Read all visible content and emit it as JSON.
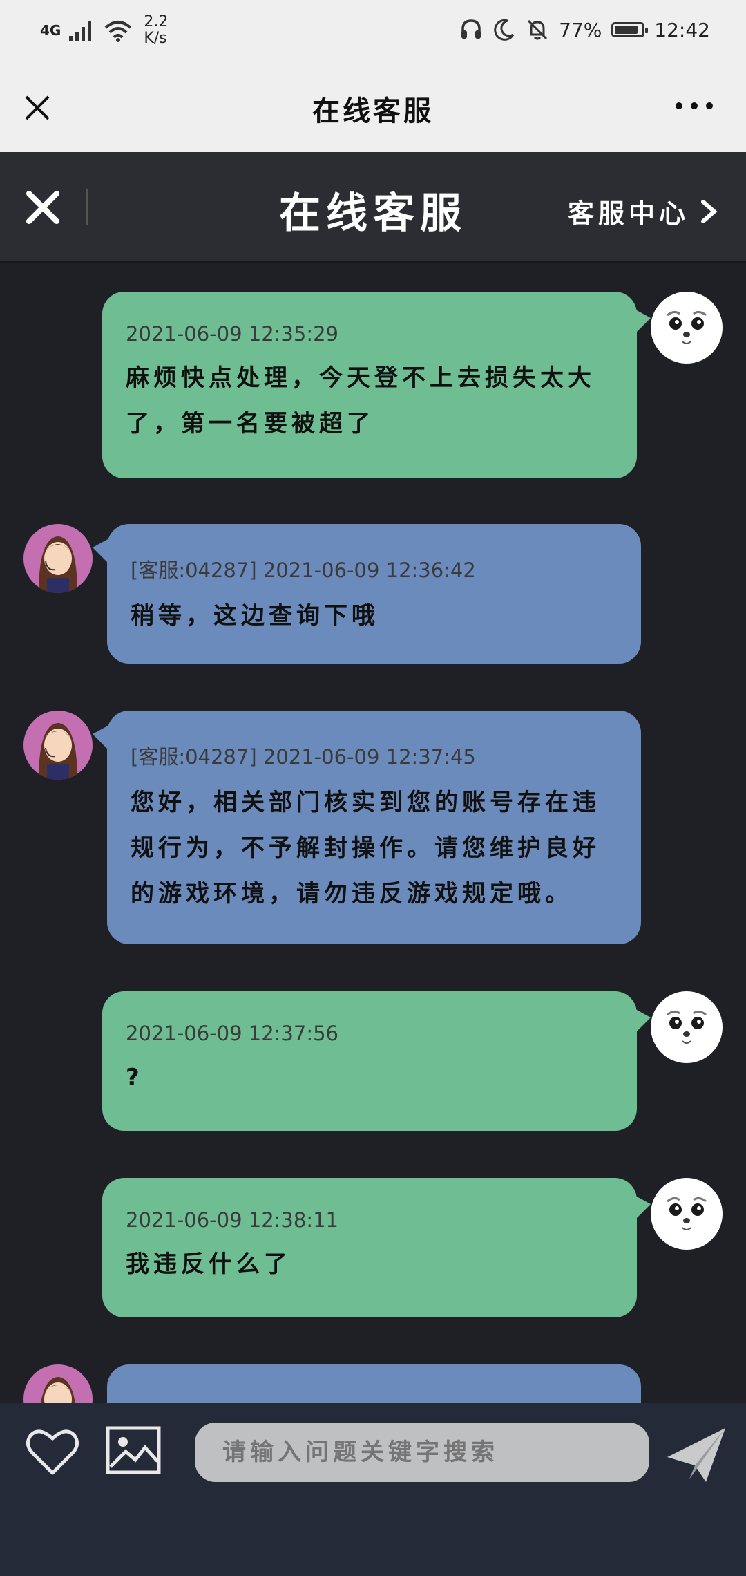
{
  "status_bar": {
    "network": "4G",
    "speed_value": "2.2",
    "speed_unit": "K/s",
    "battery": "77%",
    "battery_level": 0.77,
    "time": "12:42",
    "icons": [
      "signal-icon",
      "wifi-icon",
      "headset-icon",
      "moon-icon",
      "bell-off-icon",
      "battery-icon"
    ]
  },
  "webview": {
    "title": "在线客服"
  },
  "header": {
    "title": "在线客服",
    "service_center": "客服中心"
  },
  "messages": [
    {
      "side": "user",
      "timestamp": "2021-06-09 12:35:29",
      "text": "麻烦快点处理，今天登不上去损失太大了，第一名要被超了"
    },
    {
      "side": "agent",
      "timestamp": "[客服:04287] 2021-06-09 12:36:42",
      "text": "稍等，这边查询下哦"
    },
    {
      "side": "agent",
      "timestamp": "[客服:04287] 2021-06-09 12:37:45",
      "text": "您好，相关部门核实到您的账号存在违规行为，不予解封操作。请您维护良好的游戏环境，请勿违反游戏规定哦。"
    },
    {
      "side": "user",
      "timestamp": "2021-06-09 12:37:56",
      "text": "?"
    },
    {
      "side": "user",
      "timestamp": "2021-06-09 12:38:11",
      "text": "我违反什么了"
    }
  ],
  "input_bar": {
    "placeholder": "请输入问题关键字搜索"
  },
  "colors": {
    "user_bubble": "#6fbd92",
    "agent_bubble": "#6c8bbd",
    "chat_bg": "#1f2026",
    "header_bg": "#2c2d33",
    "input_bg": "#252a38"
  }
}
